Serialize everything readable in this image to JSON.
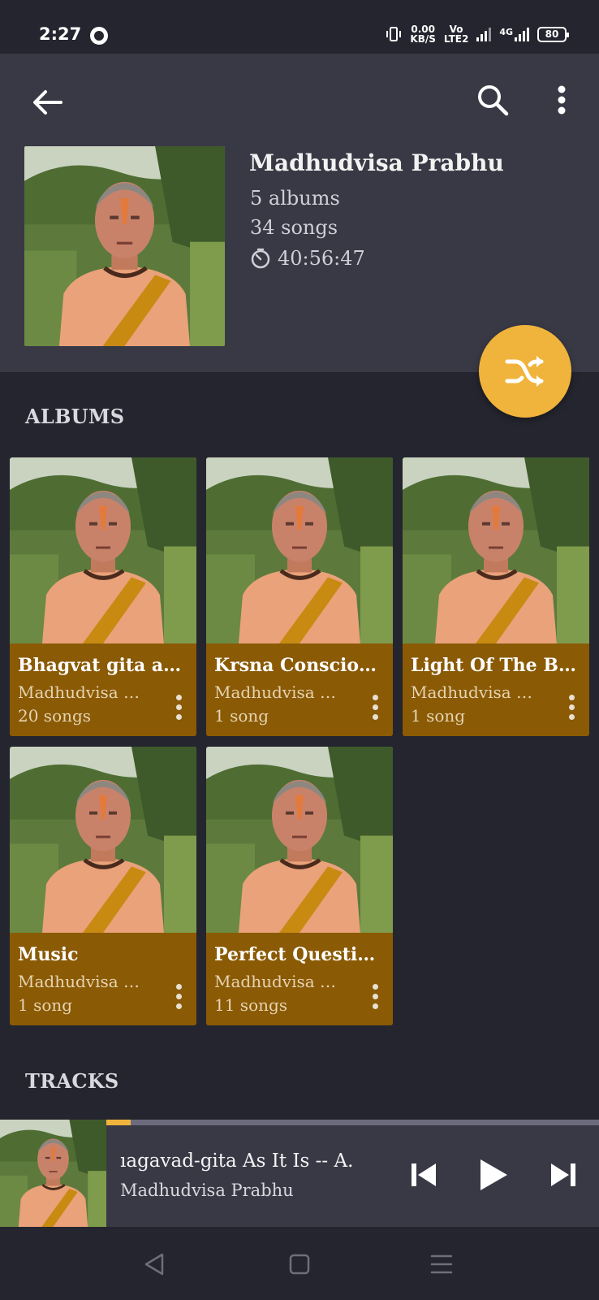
{
  "status_bar": {
    "time": "2:27",
    "net_speed_value": "0.00",
    "net_speed_unit": "KB/S",
    "volte_top": "Vo",
    "volte_bottom": "LTE2",
    "network_type": "4G",
    "battery": "80"
  },
  "header": {
    "artist_name": "Madhudvisa Prabhu",
    "albums_count": "5 albums",
    "songs_count": "34 songs",
    "duration": "40:56:47"
  },
  "sections": {
    "albums": "ALBUMS",
    "tracks": "TRACKS"
  },
  "albums": [
    {
      "title": "Bhagvat gita as it is",
      "artist": "Madhudvisa Prabhu",
      "count": "20 songs"
    },
    {
      "title": "Krsna Consciousness",
      "artist": "Madhudvisa Prabhu",
      "count": "1 song"
    },
    {
      "title": "Light Of The Bhagavata",
      "artist": "Madhudvisa Prabhu",
      "count": "1 song"
    },
    {
      "title": "Music",
      "artist": "Madhudvisa Prabhu",
      "count": "1 song"
    },
    {
      "title": "Perfect Questions",
      "artist": "Madhudvisa Prabhu",
      "count": "11 songs"
    }
  ],
  "now_playing": {
    "title": "ıagavad-gita As It Is -- A.",
    "artist": "Madhudvisa Prabhu",
    "progress": 0.05
  },
  "icons": {
    "back": "arrow-left-icon",
    "search": "search-icon",
    "more": "more-vert-icon",
    "timer": "timer-icon",
    "shuffle": "shuffle-icon",
    "prev": "skip-previous-icon",
    "play": "play-icon",
    "next": "skip-next-icon"
  },
  "colors": {
    "accent": "#f0b43c",
    "album_card": "#8a5a05",
    "header_bg": "#393946",
    "page_bg": "#25252f"
  }
}
